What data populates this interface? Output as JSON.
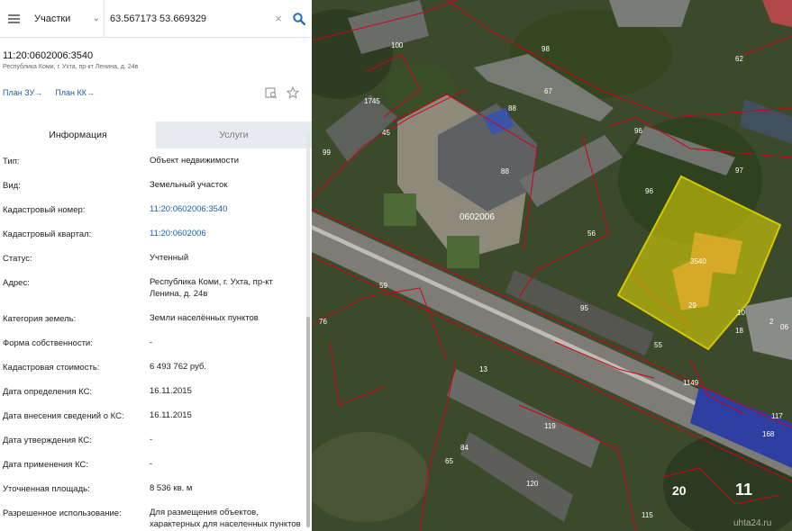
{
  "search": {
    "type_label": "Участки",
    "query": "63.567173 53.669329"
  },
  "object": {
    "title": "11:20:0602006:3540",
    "subtitle": "Республика Коми, г. Ухта, пр-кт Ленина, д. 24в",
    "plan_zu": "План ЗУ",
    "plan_kk": "План КК"
  },
  "tabs": [
    {
      "label": "Информация"
    },
    {
      "label": "Услуги"
    }
  ],
  "rows": [
    {
      "label": "Тип:",
      "value": "Объект недвижимости"
    },
    {
      "label": "Вид:",
      "value": "Земельный участок"
    },
    {
      "label": "Кадастровый номер:",
      "value": "11:20:0602006:3540"
    },
    {
      "label": "Кадастровый квартал:",
      "value": "11:20:0602006"
    },
    {
      "label": "Статус:",
      "value": "Учтенный"
    },
    {
      "label": "Адрес:",
      "value": "Республика Коми, г. Ухта, пр-кт Ленина, д. 24в"
    },
    {
      "label": "Категория земель:",
      "value": "Земли населённых пунктов"
    },
    {
      "label": "Форма собственности:",
      "value": "-"
    },
    {
      "label": "Кадастровая стоимость:",
      "value": "6 493 762 руб."
    },
    {
      "label": "Дата определения КС:",
      "value": "16.11.2015"
    },
    {
      "label": "Дата внесения сведений о КС:",
      "value": "16.11.2015"
    },
    {
      "label": "Дата утверждения КС:",
      "value": "-"
    },
    {
      "label": "Дата применения КС:",
      "value": "-"
    },
    {
      "label": "Уточненная площадь:",
      "value": "8 536 кв. м"
    },
    {
      "label": "Разрешенное использование:",
      "value": "Для размещения объектов, характерных для населенных пунктов"
    }
  ],
  "map": {
    "quarter_label": "0602006",
    "parcel_label": "3540",
    "parcel_small_label": "29",
    "road_numbers": [
      "20",
      "11"
    ],
    "parcel_numbers": [
      "100",
      "98",
      "62",
      "67",
      "88",
      "88",
      "1745",
      "45",
      "99",
      "96",
      "97",
      "56",
      "95",
      "55",
      "1149",
      "119",
      "84",
      "120",
      "65",
      "115",
      "76",
      "117",
      "168",
      "2",
      "06",
      "13",
      "18",
      "10",
      "96",
      "59"
    ],
    "watermark": "uhta24.ru",
    "colors": {
      "parcel_fill": "#e8e000",
      "boundary": "#d0001a",
      "selected_border": "#d4c800"
    }
  }
}
